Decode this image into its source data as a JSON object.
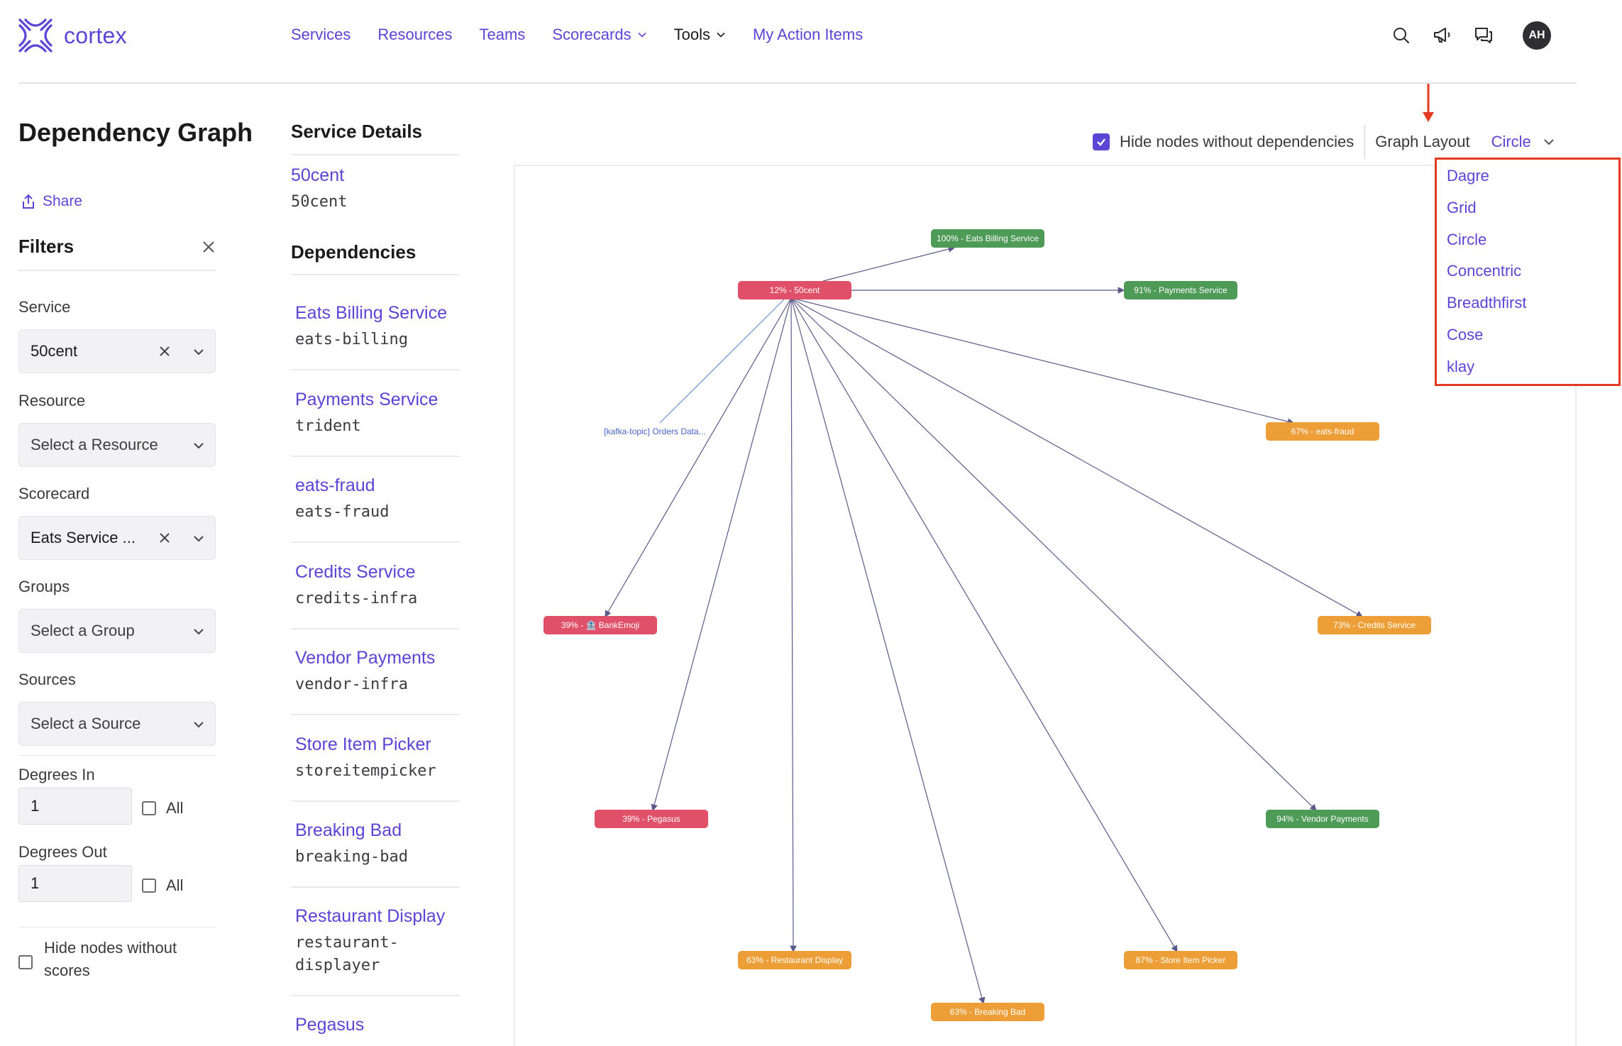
{
  "brand": {
    "name": "cortex",
    "color": "#5b45d6"
  },
  "nav": {
    "items": [
      {
        "label": "Services",
        "style": "link"
      },
      {
        "label": "Resources",
        "style": "link"
      },
      {
        "label": "Teams",
        "style": "link"
      },
      {
        "label": "Scorecards",
        "style": "link",
        "dropdown": true
      },
      {
        "label": "Tools",
        "style": "dark",
        "dropdown": true
      },
      {
        "label": "My Action Items",
        "style": "link"
      }
    ],
    "icons": [
      "search-icon",
      "megaphone-icon",
      "chat-icon"
    ],
    "avatar_initials": "AH"
  },
  "page": {
    "title": "Dependency Graph",
    "share_label": "Share"
  },
  "filters": {
    "title": "Filters",
    "service": {
      "label": "Service",
      "value": "50cent"
    },
    "resource": {
      "label": "Resource",
      "placeholder": "Select a Resource"
    },
    "scorecard": {
      "label": "Scorecard",
      "value": "Eats Service ..."
    },
    "groups": {
      "label": "Groups",
      "placeholder": "Select a Group"
    },
    "sources": {
      "label": "Sources",
      "placeholder": "Select a Source"
    },
    "degrees_in": {
      "label": "Degrees In",
      "value": "1",
      "all_label": "All"
    },
    "degrees_out": {
      "label": "Degrees Out",
      "value": "1",
      "all_label": "All"
    },
    "hide_no_scores": {
      "label_line1": "Hide nodes without",
      "label_line2": "scores"
    }
  },
  "service_details": {
    "title": "Service Details",
    "service": {
      "name": "50cent",
      "tag": "50cent"
    },
    "dependencies_title": "Dependencies",
    "dependencies": [
      {
        "name": "Eats Billing Service",
        "tag": "eats-billing"
      },
      {
        "name": "Payments Service",
        "tag": "trident"
      },
      {
        "name": "eats-fraud",
        "tag": "eats-fraud"
      },
      {
        "name": "Credits Service",
        "tag": "credits-infra"
      },
      {
        "name": "Vendor Payments",
        "tag": "vendor-infra"
      },
      {
        "name": "Store Item Picker",
        "tag": "storeitempicker"
      },
      {
        "name": "Breaking Bad",
        "tag": "breaking-bad"
      },
      {
        "name": "Restaurant Display",
        "tag_line1": "restaurant-",
        "tag_line2": "displayer"
      },
      {
        "name": "Pegasus"
      }
    ]
  },
  "graph_toolbar": {
    "hide_nodes_label": "Hide nodes without dependencies",
    "hide_nodes_checked": true,
    "layout_label": "Graph Layout",
    "layout_value": "Circle"
  },
  "layout_options": [
    "Dagre",
    "Grid",
    "Circle",
    "Concentric",
    "Breadthfirst",
    "Cose",
    "klay"
  ],
  "graph": {
    "nodes": [
      {
        "id": "center",
        "label": "12% - 50cent",
        "status": "red"
      },
      {
        "id": "billing",
        "label": "100% - Eats Billing Service",
        "status": "green"
      },
      {
        "id": "payments",
        "label": "91% - Payments Service",
        "status": "green"
      },
      {
        "id": "fraud",
        "label": "67% - eats-fraud",
        "status": "orange"
      },
      {
        "id": "credits",
        "label": "73% - Credits Service",
        "status": "orange"
      },
      {
        "id": "vendor",
        "label": "94% - Vendor Payments",
        "status": "green"
      },
      {
        "id": "store",
        "label": "87% - Store Item Picker",
        "status": "orange"
      },
      {
        "id": "breaking",
        "label": "63% - Breaking Bad",
        "status": "orange"
      },
      {
        "id": "restaurant",
        "label": "63% - Restaurant Display",
        "status": "orange"
      },
      {
        "id": "pegasus",
        "label": "39% - Pegasus",
        "status": "red"
      },
      {
        "id": "bankemoji",
        "label": "39% - 🏦 BankEmoji",
        "status": "red"
      },
      {
        "id": "kafka",
        "label": "[kafka-topic] Orders Data...",
        "status": "kafka"
      }
    ],
    "colors": {
      "red": "#e05068",
      "green": "#4e9a57",
      "orange": "#ee9e36",
      "edge": "#5a5a8a",
      "kafka_edge": "#6a8fd6"
    }
  }
}
